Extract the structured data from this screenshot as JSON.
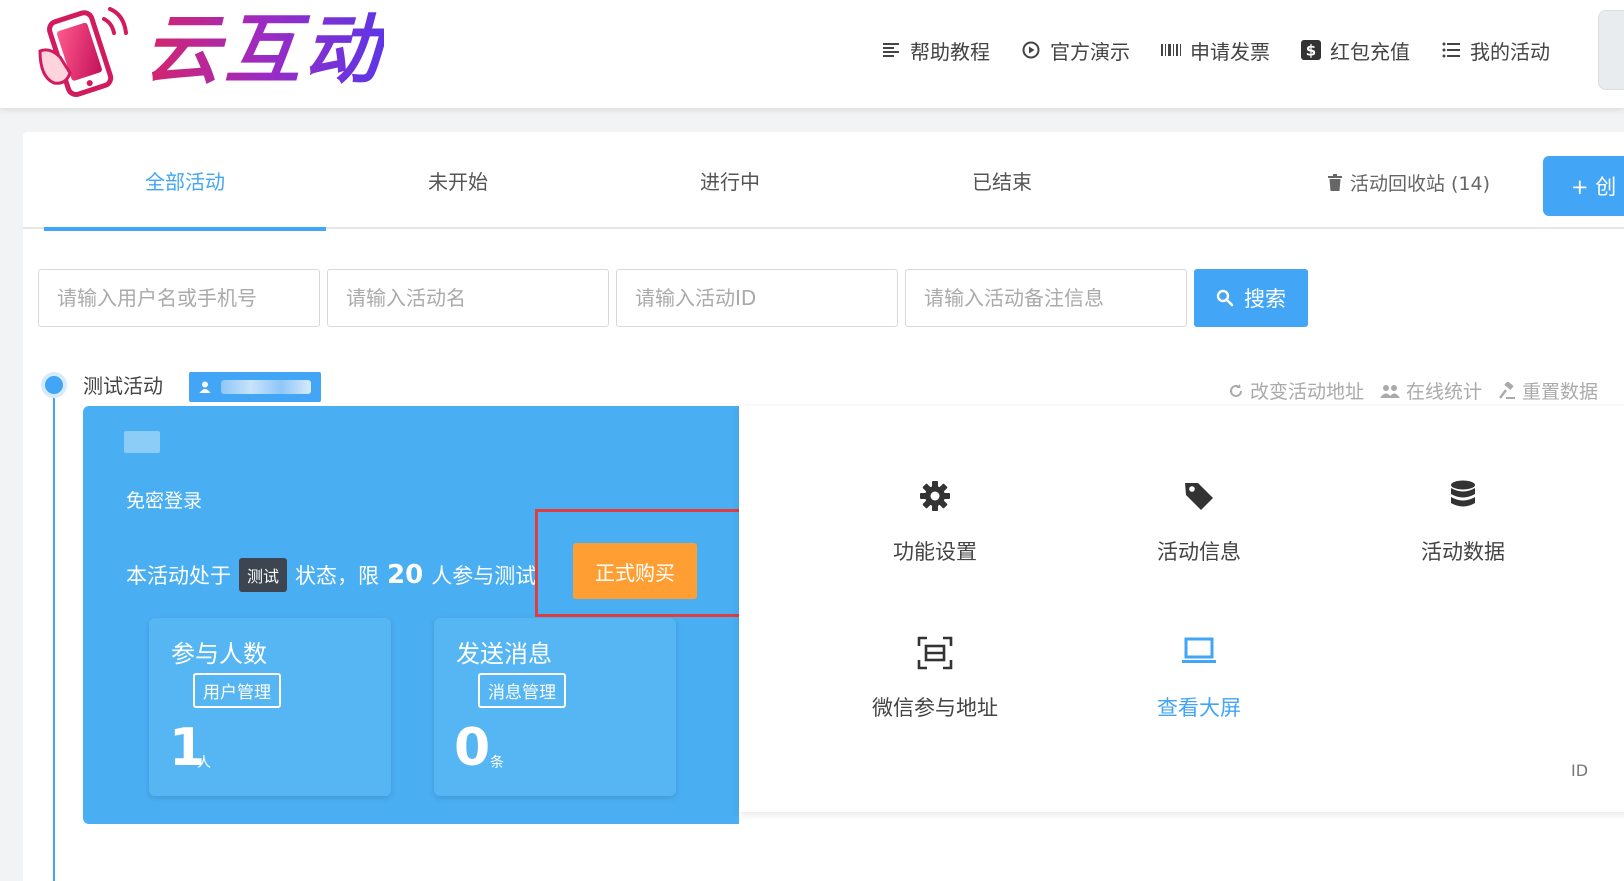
{
  "header": {
    "logo_text": "云互动",
    "nav": [
      {
        "label": "帮助教程",
        "icon": "document-list-icon"
      },
      {
        "label": "官方演示",
        "icon": "play-circle-icon"
      },
      {
        "label": "申请发票",
        "icon": "barcode-icon"
      },
      {
        "label": "红包充值",
        "icon": "dollar-icon"
      },
      {
        "label": "我的活动",
        "icon": "list-icon"
      }
    ]
  },
  "tabs": [
    {
      "label": "全部活动",
      "active": true
    },
    {
      "label": "未开始",
      "active": false
    },
    {
      "label": "进行中",
      "active": false
    },
    {
      "label": "已结束",
      "active": false
    }
  ],
  "recycle_label": "活动回收站 (14)",
  "create_label": "+ 创",
  "search": {
    "user_placeholder": "请输入用户名或手机号",
    "name_placeholder": "请输入活动名",
    "id_placeholder": "请输入活动ID",
    "note_placeholder": "请输入活动备注信息",
    "button_label": "搜索"
  },
  "activity": {
    "title": "测试活动",
    "actions": [
      "改变活动地址",
      "在线统计",
      "重置数据"
    ],
    "nologin_label": "免密登录",
    "status_prefix": "本活动处于",
    "status_badge": "测试",
    "status_mid": "状态，限",
    "status_limit": "20",
    "status_suffix": "人参与测试",
    "buy_label": "正式购买",
    "stats": [
      {
        "label": "参与人数",
        "manage": "用户管理",
        "value": "1",
        "unit": "人"
      },
      {
        "label": "发送消息",
        "manage": "消息管理",
        "value": "0",
        "unit": "条"
      }
    ],
    "functions": [
      {
        "label": "功能设置",
        "icon": "gear-icon"
      },
      {
        "label": "活动信息",
        "icon": "tag-icon"
      },
      {
        "label": "活动数据",
        "icon": "database-icon"
      },
      {
        "label": "微信参与地址",
        "icon": "scan-frame-icon"
      },
      {
        "label": "查看大屏",
        "icon": "laptop-icon"
      }
    ],
    "id_fragment": "ID"
  },
  "colors": {
    "primary": "#42a5f5",
    "card_blue": "#4aaef2",
    "buy_orange": "#ff9f33",
    "highlight_red": "#e03e3e"
  }
}
